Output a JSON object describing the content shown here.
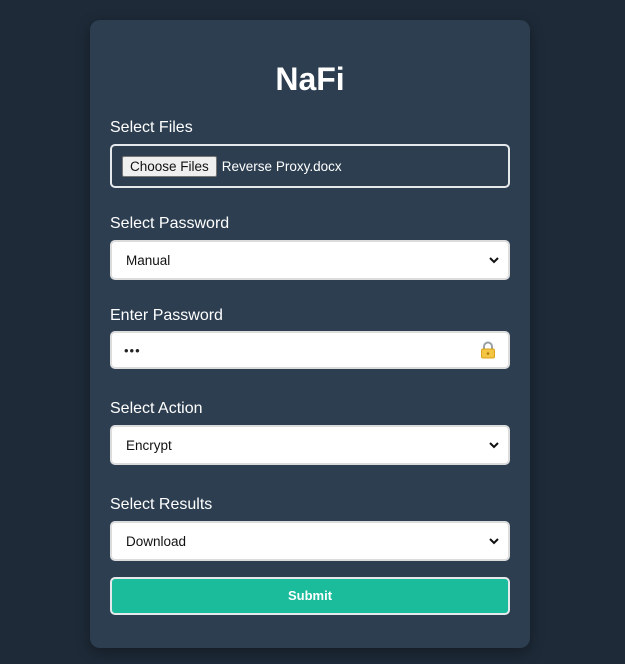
{
  "app": {
    "title": "NaFi"
  },
  "form": {
    "files": {
      "label": "Select Files",
      "button_label": "Choose Files",
      "selected_file": "Reverse Proxy.docx"
    },
    "password_type": {
      "label": "Select Password",
      "selected": "Manual"
    },
    "password": {
      "label": "Enter Password",
      "masked_value": "•••",
      "icon": "lock-icon"
    },
    "action": {
      "label": "Select Action",
      "selected": "Encrypt"
    },
    "results": {
      "label": "Select Results",
      "selected": "Download"
    },
    "submit_label": "Submit"
  },
  "colors": {
    "page_background": "#1e2a38",
    "card_background": "#2c3e50",
    "submit_accent": "#1abc9c"
  }
}
